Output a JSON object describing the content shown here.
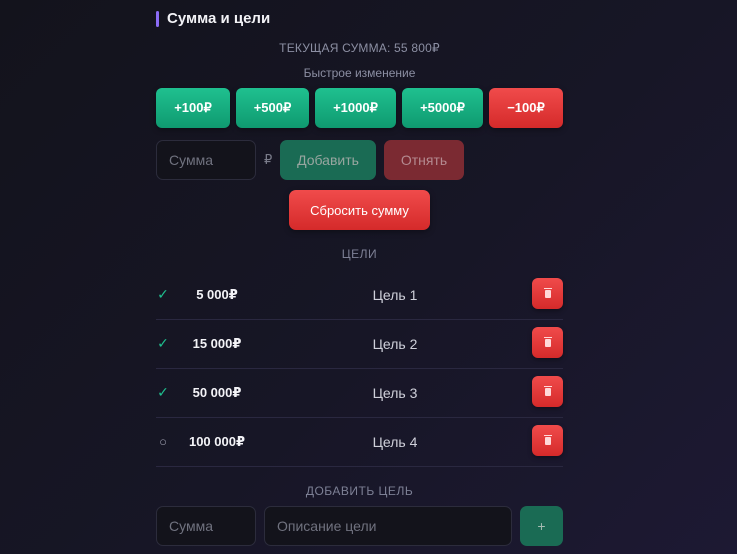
{
  "section": {
    "title": "Сумма и цели"
  },
  "current_sum": {
    "label": "ТЕКУЩАЯ СУММА: 55 800₽"
  },
  "quick_change": {
    "label": "Быстрое изменение",
    "buttons": [
      "+100₽",
      "+500₽",
      "+1000₽",
      "+5000₽",
      "−100₽"
    ]
  },
  "amount_form": {
    "placeholder": "Сумма",
    "currency": "₽",
    "add_label": "Добавить",
    "subtract_label": "Отнять",
    "reset_label": "Сбросить сумму"
  },
  "goals": {
    "title": "ЦЕЛИ",
    "items": [
      {
        "status": "✓",
        "amount": "5 000₽",
        "name": "Цель 1"
      },
      {
        "status": "✓",
        "amount": "15 000₽",
        "name": "Цель 2"
      },
      {
        "status": "✓",
        "amount": "50 000₽",
        "name": "Цель 3"
      },
      {
        "status": "○",
        "amount": "100 000₽",
        "name": "Цель 4"
      }
    ]
  },
  "add_goal": {
    "title": "ДОБАВИТЬ ЦЕЛЬ",
    "amount_placeholder": "Сумма",
    "description_placeholder": "Описание цели",
    "add_label": "+"
  },
  "colors": {
    "accent": "#8b6cf6",
    "green": "#1fc08f",
    "red": "#f04b4b",
    "background": "#171626"
  },
  "icons": {
    "delete": "trash-icon",
    "done": "check-icon",
    "pending": "circle-icon"
  }
}
